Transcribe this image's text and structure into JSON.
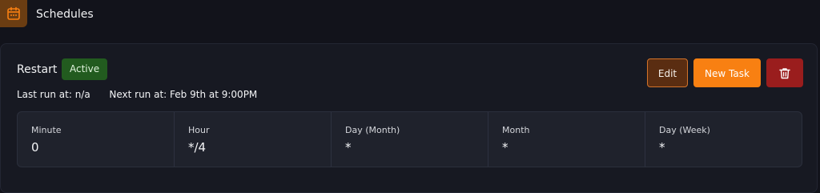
{
  "header": {
    "title": "Schedules",
    "icon": "calendar-icon",
    "accent": "#f88012"
  },
  "schedule": {
    "name": "Restart",
    "status": "Active",
    "status_color": "#225b1f",
    "last_run_label": "Last run at:",
    "last_run_value": "n/a",
    "next_run_label": "Next run at:",
    "next_run_value": "Feb 9th at 9:00PM",
    "actions": {
      "edit_label": "Edit",
      "new_task_label": "New Task",
      "delete_icon": "trash-icon"
    },
    "cron": [
      {
        "label": "Minute",
        "value": "0"
      },
      {
        "label": "Hour",
        "value": "*/4"
      },
      {
        "label": "Day (Month)",
        "value": "*"
      },
      {
        "label": "Month",
        "value": "*"
      },
      {
        "label": "Day (Week)",
        "value": "*"
      }
    ]
  }
}
